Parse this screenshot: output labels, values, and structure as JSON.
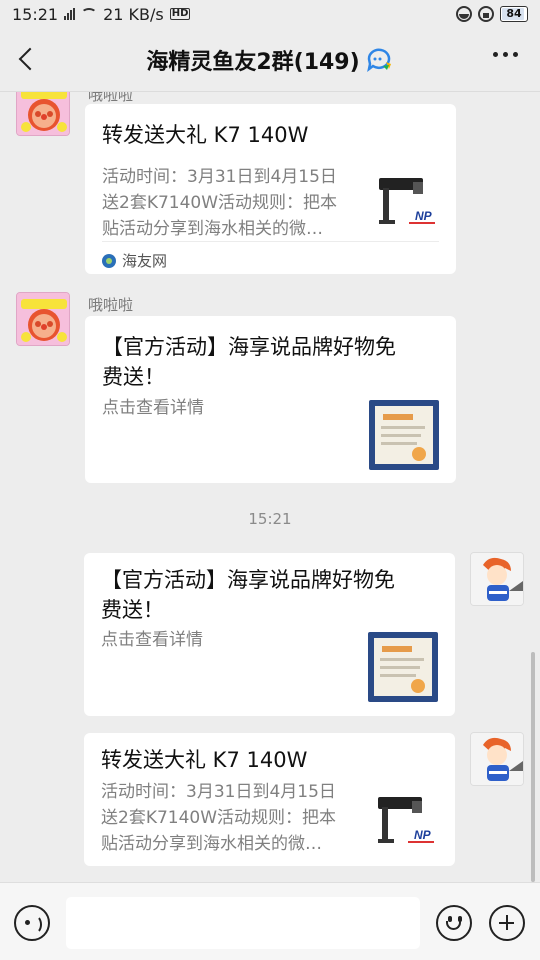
{
  "status_bar": {
    "time": "15:21",
    "network_speed": "21 KB/s",
    "hd_label": "HD",
    "battery": "84"
  },
  "header": {
    "title": "海精灵鱼友2群(149)",
    "back_icon": "back-arrow-icon",
    "more_icon": "more-dots-icon"
  },
  "messages": [
    {
      "direction": "incoming",
      "sender": "哦啦啦",
      "title": "转发送大礼 K7 140W",
      "desc_lines": [
        "活动时间：3月31日到4月15日",
        "送2套K7140W活动规则：把本",
        "贴活动分享到海水相关的微…"
      ],
      "source": "海友网",
      "thumb_text": "NP"
    },
    {
      "direction": "incoming",
      "sender": "哦啦啦",
      "title_lines": [
        "【官方活动】海享说品牌好物免",
        "费送！"
      ],
      "desc": "点击查看详情"
    },
    {
      "timestamp": "15:21"
    },
    {
      "direction": "outgoing",
      "title_lines": [
        "【官方活动】海享说品牌好物免",
        "费送！"
      ],
      "desc": "点击查看详情"
    },
    {
      "direction": "outgoing",
      "title": "转发送大礼 K7 140W",
      "desc_lines": [
        "活动时间：3月31日到4月15日",
        "送2套K7140W活动规则：把本",
        "贴活动分享到海水相关的微…"
      ],
      "thumb_text": "NP"
    }
  ],
  "input_bar": {
    "voice_icon": "voice-icon",
    "emoji_icon": "emoji-icon",
    "plus_icon": "plus-icon"
  },
  "colors": {
    "background": "#ededed",
    "card": "#ffffff",
    "secondary_text": "#808080"
  }
}
